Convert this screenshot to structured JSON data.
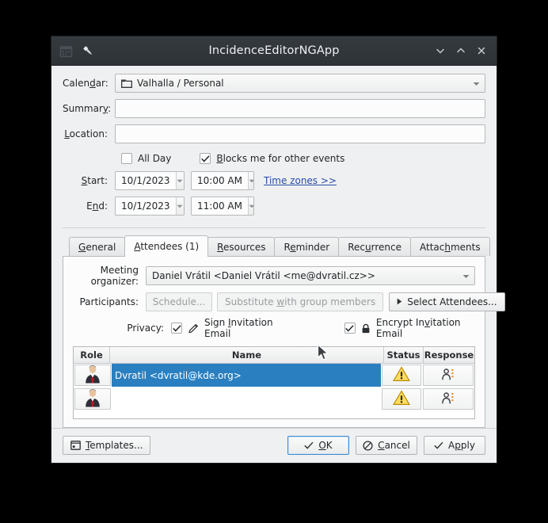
{
  "window": {
    "title": "IncidenceEditorNGApp",
    "titlebar_icons": [
      "calendar-icon",
      "pin-icon"
    ],
    "controls": {
      "minimize": "chevron-down-icon",
      "maximize": "chevron-up-icon",
      "close": "close-icon"
    }
  },
  "colors": {
    "titlebar_bg": "#2e3338",
    "window_bg": "#eff0f1",
    "selection_blue": "#2a7fc0",
    "link_blue": "#2a4ca8",
    "warning_yellow": "#f7c325",
    "default_button_border": "#3e8ad2"
  },
  "form": {
    "calendar": {
      "label": "Calendar:",
      "value": "Valhalla / Personal",
      "icon": "folder-icon"
    },
    "summary": {
      "label": "Summary:",
      "value": "",
      "placeholder": ""
    },
    "location": {
      "label": "Location:",
      "value": "",
      "placeholder": ""
    },
    "all_day": {
      "label": "All Day",
      "checked": false
    },
    "blocks_me": {
      "label": "Blocks me for other events",
      "checked": true
    },
    "start": {
      "label": "Start:",
      "date": "10/1/2023",
      "time": "10:00 AM"
    },
    "end": {
      "label": "End:",
      "date": "10/1/2023",
      "time": "11:00 AM"
    },
    "time_zones_link": "Time zones >>"
  },
  "tabs": [
    {
      "label": "General",
      "active": false
    },
    {
      "label": "Attendees (1)",
      "active": true
    },
    {
      "label": "Resources",
      "active": false
    },
    {
      "label": "Reminder",
      "active": false
    },
    {
      "label": "Recurrence",
      "active": false
    },
    {
      "label": "Attachments",
      "active": false
    }
  ],
  "attendees_tab": {
    "organizer": {
      "label": "Meeting organizer:",
      "value": "Daniel Vrátil <Daniel Vrátil <me@dvratil.cz>>"
    },
    "participants": {
      "label": "Participants:",
      "schedule_button": "Schedule...",
      "schedule_enabled": false,
      "substitute_button": "Substitute with group members",
      "substitute_enabled": false,
      "select_attendees_button": "Select Attendees...",
      "select_attendees_icon": "triangle-right-icon"
    },
    "privacy": {
      "label": "Privacy:",
      "sign": {
        "label": "Sign Invitation Email",
        "checked": true,
        "icon": "pen-icon"
      },
      "encrypt": {
        "label": "Encrypt Invitation Email",
        "checked": true,
        "icon": "lock-icon"
      }
    },
    "table": {
      "columns": [
        "Role",
        "Name",
        "Status",
        "Response"
      ],
      "rows": [
        {
          "role_icon": "person-avatar-icon",
          "name": "Dvratil <dvratil@kde.org>",
          "status_icon": "warning-icon",
          "response_icon": "person-options-icon",
          "selected": true
        },
        {
          "role_icon": "person-avatar-icon",
          "name": "",
          "status_icon": "warning-icon",
          "response_icon": "person-options-icon",
          "selected": false
        }
      ]
    }
  },
  "footer": {
    "templates": {
      "label": "Templates...",
      "icon": "template-window-icon"
    },
    "ok": {
      "label": "OK",
      "icon": "check-icon",
      "default": true
    },
    "cancel": {
      "label": "Cancel",
      "icon": "forbidden-icon"
    },
    "apply": {
      "label": "Apply",
      "icon": "check-icon"
    }
  }
}
